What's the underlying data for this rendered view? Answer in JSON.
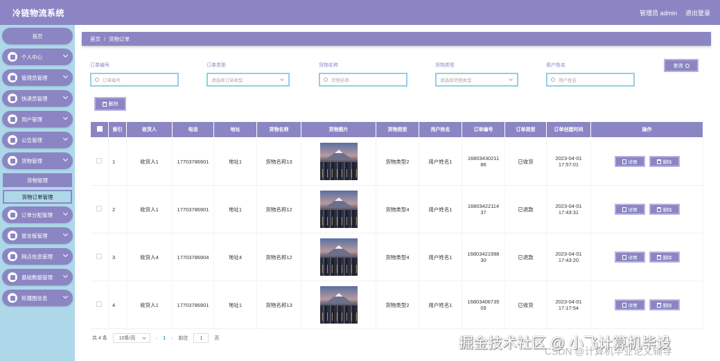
{
  "header": {
    "title": "冷链物流系统",
    "user": "管理员 admin",
    "logout": "退出登录"
  },
  "sidebar": {
    "home": "首页",
    "items": [
      {
        "label": "个人中心",
        "icon": "user-icon"
      },
      {
        "label": "管理员管理",
        "icon": "admin-icon"
      },
      {
        "label": "快递员管理",
        "icon": "courier-icon"
      },
      {
        "label": "用户管理",
        "icon": "users-icon"
      },
      {
        "label": "公告管理",
        "icon": "notice-icon"
      },
      {
        "label": "货物管理",
        "icon": "goods-icon"
      }
    ],
    "sub_items": [
      {
        "label": "货物管理"
      },
      {
        "label": "货物订单管理"
      }
    ],
    "items_after": [
      {
        "label": "订单分配管理",
        "icon": "assign-icon"
      },
      {
        "label": "留言板管理",
        "icon": "message-icon"
      },
      {
        "label": "网点信息管理",
        "icon": "branch-icon"
      },
      {
        "label": "基础数据管理",
        "icon": "data-icon"
      },
      {
        "label": "轮播图信息",
        "icon": "carousel-icon"
      }
    ]
  },
  "breadcrumb": {
    "home": "首页",
    "sep": "/",
    "current": "货物订单"
  },
  "search": {
    "order_no": {
      "label": "订单编号",
      "placeholder": "订单编号"
    },
    "order_type": {
      "label": "订单类型",
      "placeholder": "请选择订单类型"
    },
    "goods_name": {
      "label": "货物名称",
      "placeholder": "货物名称"
    },
    "goods_type": {
      "label": "货物类型",
      "placeholder": "请选择货物类型"
    },
    "user_name": {
      "label": "用户姓名",
      "placeholder": "用户姓名"
    },
    "query_label": "查询"
  },
  "delete_label": "删除",
  "table": {
    "columns": [
      "索引",
      "收货人",
      "电话",
      "地址",
      "货物名称",
      "货物图片",
      "货物类型",
      "用户姓名",
      "订单编号",
      "订单类型",
      "订单创建时间",
      "操作"
    ],
    "rows": [
      {
        "index": "1",
        "receiver": "收货人1",
        "phone": "17703786901",
        "address": "地址1",
        "goods": "货物名称13",
        "goods_type": "货物类型2",
        "user": "用户姓名1",
        "order_no": "1680343021186",
        "order_type": "已收货",
        "created": "2023-04-01 17:57:01"
      },
      {
        "index": "2",
        "receiver": "收货人1",
        "phone": "17703786901",
        "address": "地址1",
        "goods": "货物名称12",
        "goods_type": "货物类型4",
        "user": "用户姓名1",
        "order_no": "1680342211437",
        "order_type": "已退款",
        "created": "2023-04-01 17:43:31"
      },
      {
        "index": "3",
        "receiver": "收货人4",
        "phone": "17703786904",
        "address": "地址4",
        "goods": "货物名称12",
        "goods_type": "货物类型4",
        "user": "用户姓名1",
        "order_no": "1680342199830",
        "order_type": "已退款",
        "created": "2023-04-01 17:43:20"
      },
      {
        "index": "4",
        "receiver": "收货人1",
        "phone": "17703786901",
        "address": "地址1",
        "goods": "货物名称13",
        "goods_type": "货物类型2",
        "user": "用户姓名1",
        "order_no": "1680340673509",
        "order_type": "已收货",
        "created": "2023-04-01 17:17:54"
      }
    ],
    "detail_label": "详情",
    "delete_label": "删除"
  },
  "pager": {
    "total": "共 4 条",
    "page_size": "10条/页",
    "prev": "‹",
    "current": "1",
    "next": "›",
    "goto": "前往",
    "goto_value": "1",
    "page_unit": "页"
  },
  "watermark": {
    "main": "掘金技术社区 @ 小飞计算机毕设",
    "sub": "CSDN @计算机毕业论文辅导"
  },
  "colors": {
    "primary": "#8b86c3",
    "sidebar_bg": "#aed8ea",
    "input_border": "#8fd0e6"
  }
}
